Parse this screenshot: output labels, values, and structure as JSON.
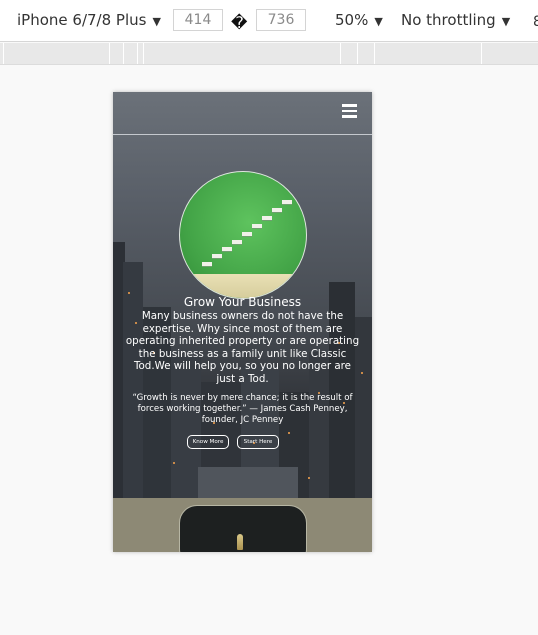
{
  "toolbar": {
    "device_name": "iPhone 6/7/8 Plus",
    "width_value": "414",
    "height_value": "736",
    "swap_glyph": "�",
    "zoom": "50%",
    "throttling": "No throttling",
    "overflow_glyph": "8"
  },
  "page": {
    "hero_title": "Grow Your Business",
    "hero_description": "Many business owners do not have the expertise. Why since most of them are operating inherited property or are operating the business as a family unit like Classic Tod.We will help you, so you no longer are just a Tod.",
    "hero_quote": "“Growth is never by mere chance; it is the result of forces working together.” — James Cash Penney, founder, JC Penney",
    "know_more_label": "Know More",
    "start_here_label": "Start Here"
  },
  "colors": {
    "hero_overlay": "#4a5058",
    "section2_bg": "#8d8975",
    "circle_green": "#43a447"
  },
  "icons": {
    "menu": "hamburger-menu-icon",
    "caret": "caret-down-icon"
  }
}
